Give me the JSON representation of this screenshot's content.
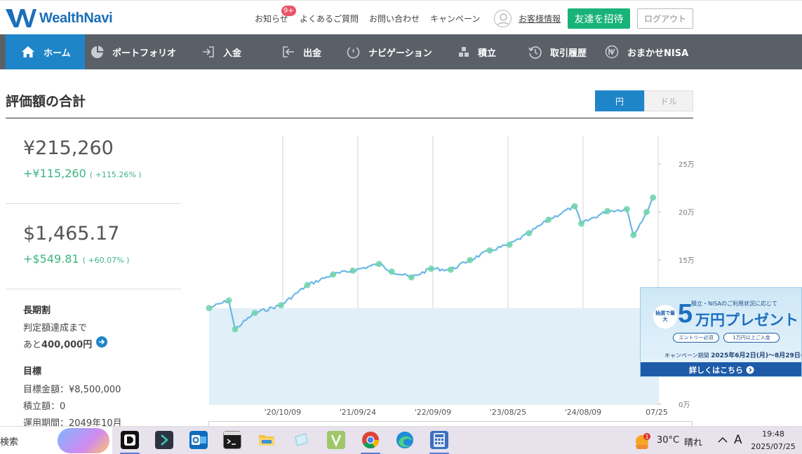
{
  "header": {
    "logo_text": "WealthNavi",
    "links": {
      "notifications": "お知らせ",
      "faq": "よくあるご質問",
      "contact": "お問い合わせ",
      "campaign": "キャンペーン",
      "customer_info": "お客様情報"
    },
    "notification_badge": "9+",
    "invite_button": "友達を招待",
    "logout_button": "ログアウト"
  },
  "nav": {
    "items": [
      {
        "label": "ホーム",
        "icon": "home-icon",
        "active": true
      },
      {
        "label": "ポートフォリオ",
        "icon": "pie-chart-icon"
      },
      {
        "label": "入金",
        "icon": "deposit-icon"
      },
      {
        "label": "出金",
        "icon": "withdraw-icon"
      },
      {
        "label": "ナビゲーション",
        "icon": "navigation-icon"
      },
      {
        "label": "積立",
        "icon": "accumulate-icon"
      },
      {
        "label": "取引履歴",
        "icon": "history-icon"
      },
      {
        "label": "おまかせNISA",
        "icon": "nisa-icon"
      }
    ]
  },
  "main": {
    "title": "評価額の合計",
    "currency_toggle": {
      "yen": "円",
      "dollar": "ドル",
      "selected": "円"
    },
    "yen_total": "¥215,260",
    "yen_gain": "+¥115,260",
    "yen_gain_pct": "( +115.26% )",
    "usd_total": "$1,465.17",
    "usd_gain": "+$549.81",
    "usd_gain_pct": "( +60.07% )",
    "long_term": {
      "title": "長期割",
      "line1": "判定額達成まで",
      "line2_prefix": "あと",
      "line2_amount": "400,000円"
    },
    "goal": {
      "title": "目標",
      "target": "目標金額：¥8,500,000",
      "accumulation": "積立額：0",
      "period": "運用期間：2049年10月"
    }
  },
  "chart_data": {
    "type": "line",
    "y_tick_labels": [
      "25万",
      "20万",
      "15万",
      "0万"
    ],
    "x_tick_labels": [
      "'20/10/09",
      "'21/09/24",
      "'22/09/09",
      "'23/08/25",
      "'24/08/09",
      "07/25"
    ],
    "ylim": [
      0,
      250000
    ],
    "series": [
      {
        "x": [
          "2019-11",
          "2020-02",
          "2020-03",
          "2020-06",
          "2020-10",
          "2021-02",
          "2021-06",
          "2021-09",
          "2022-01",
          "2022-03",
          "2022-06",
          "2022-09",
          "2022-12",
          "2023-03",
          "2023-06",
          "2023-09",
          "2023-12",
          "2024-03",
          "2024-07",
          "2024-08",
          "2024-12",
          "2025-03",
          "2025-04",
          "2025-06",
          "2025-07"
        ],
        "values": [
          100000,
          108000,
          78000,
          95000,
          103000,
          124000,
          135000,
          139000,
          146000,
          138000,
          132000,
          141000,
          140000,
          150000,
          160000,
          166000,
          178000,
          192000,
          206000,
          188000,
          201000,
          203000,
          176000,
          200000,
          215000
        ]
      }
    ],
    "principal": 100000,
    "grid": true
  },
  "ad": {
    "top_text": "積立・NISAのご利用状況に応じて",
    "circle_text": "抽選で最大",
    "big": "5",
    "mid": "万円プレゼント",
    "pill1": "エントリー必須",
    "pill2": "1万円以上ご入金",
    "period_label": "キャンペーン期間",
    "period_dates": "2025年6月2日(月)～8月29日(金)",
    "cta": "詳しくはこちら"
  },
  "taskbar": {
    "search_text": "検索",
    "weather_temp": "30°C",
    "weather_text": "晴れ",
    "weather_badge": "1",
    "ime": "A",
    "time": "19:48",
    "date": "2025/07/25"
  }
}
